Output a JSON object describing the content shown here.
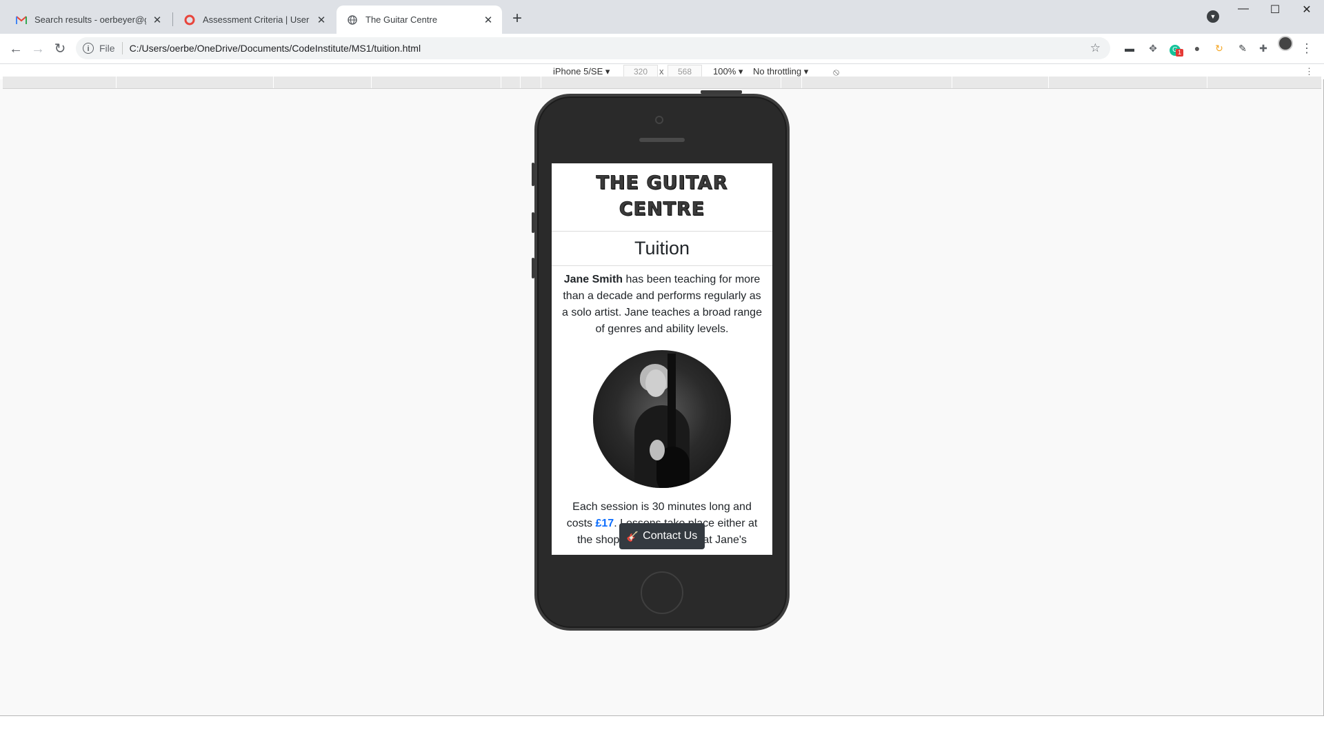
{
  "tabs": [
    {
      "title": "Search results - oerbeyer@googl",
      "favicon": "gmail-icon",
      "active": false
    },
    {
      "title": "Assessment Criteria | User Centri",
      "favicon": "code-institute-icon",
      "active": false
    },
    {
      "title": "The Guitar Centre",
      "favicon": "globe-icon",
      "active": true
    }
  ],
  "toolbar": {
    "scheme": "File",
    "url": "C:/Users/oerbe/OneDrive/Documents/CodeInstitute/MS1/tuition.html",
    "extension_badge": "1"
  },
  "device_toolbar": {
    "device": "iPhone 5/SE",
    "width": "320",
    "height": "568",
    "times": "x",
    "zoom": "100%",
    "throttling": "No throttling"
  },
  "site": {
    "logo_line1": "THE GUITAR",
    "logo_line2": "CENTRE",
    "page_title": "Tuition",
    "teacher_name": "Jane Smith",
    "intro_rest": " has been teaching for more than a decade and performs regularly as a solo artist. Jane teaches a broad range of genres and ability levels.",
    "session_text_before": "Each session is 30 minutes long and costs ",
    "session_price": "£17",
    "session_text_after": ". Lessons take place either at the shop in Colchester or at Jane's",
    "contact_button": "Contact Us"
  },
  "colors": {
    "price_link": "#0d6efd",
    "button_bg": "#343a40",
    "phone_body": "#2a2a2a"
  }
}
